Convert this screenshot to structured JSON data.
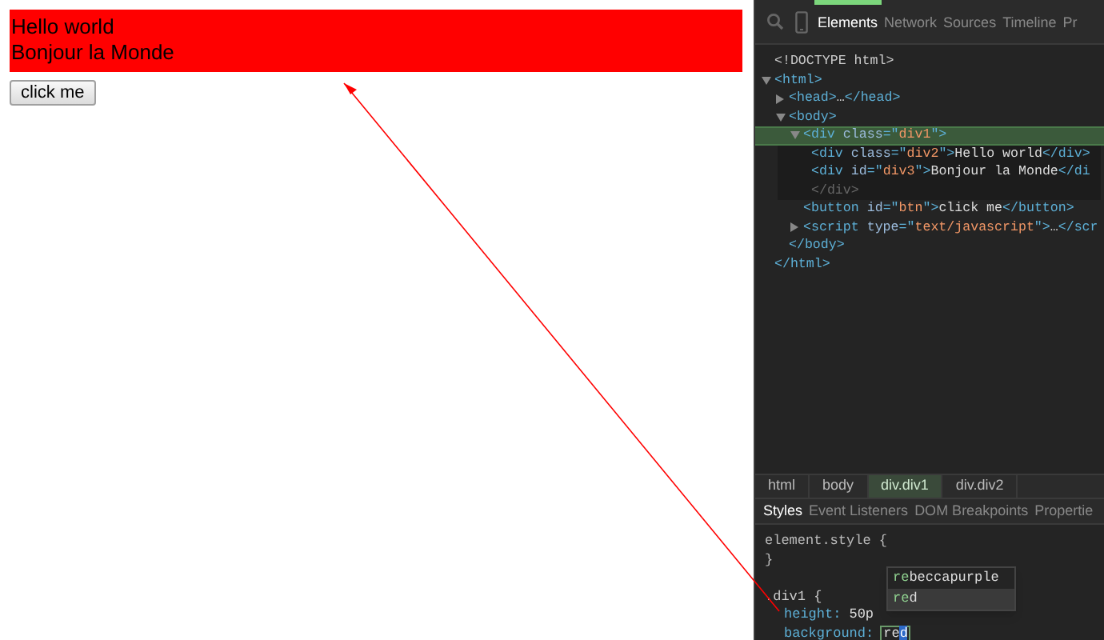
{
  "page": {
    "box_lines": [
      "Hello world",
      "Bonjour la Monde"
    ],
    "button": "click me"
  },
  "devtools": {
    "tabs": [
      {
        "label": "Elements",
        "selected": true
      },
      {
        "label": "Network",
        "selected": false
      },
      {
        "label": "Sources",
        "selected": false
      },
      {
        "label": "Timeline",
        "selected": false
      },
      {
        "label": "Pr",
        "selected": false
      }
    ],
    "tree": [
      {
        "segments": [
          {
            "doctype": "<!DOCTYPE html>"
          }
        ],
        "selected": false
      },
      {
        "segments": [
          {
            "tag": "<html>"
          }
        ],
        "expanded": true,
        "selected": false,
        "children": [
          {
            "segments": [
              {
                "tag": "<head>"
              },
              {
                "text": "…"
              },
              {
                "tag": "</head>"
              }
            ],
            "expanded": false,
            "selected": false
          },
          {
            "segments": [
              {
                "tag": "<body>"
              }
            ],
            "expanded": true,
            "selected": false,
            "children": [
              {
                "segments": [
                  {
                    "tag": "<div "
                  },
                  {
                    "attr": "class"
                  },
                  {
                    "tag": "=\""
                  },
                  {
                    "value": "div1"
                  },
                  {
                    "tag": "\">"
                  }
                ],
                "expanded": true,
                "selected": true,
                "children": [
                  {
                    "segments": [
                      {
                        "tag": "<div "
                      },
                      {
                        "attr": "class"
                      },
                      {
                        "tag": "=\""
                      },
                      {
                        "value": "div2"
                      },
                      {
                        "tag": "\">"
                      },
                      {
                        "text": "Hello world"
                      },
                      {
                        "tag": "</div>"
                      }
                    ],
                    "selected": false
                  },
                  {
                    "segments": [
                      {
                        "tag": "<div "
                      },
                      {
                        "attr": "id"
                      },
                      {
                        "tag": "=\""
                      },
                      {
                        "value": "div3"
                      },
                      {
                        "tag": "\">"
                      },
                      {
                        "text": "Bonjour la Monde"
                      },
                      {
                        "tag": "</di"
                      }
                    ],
                    "selected": false
                  }
                ],
                "closing": "</div>"
              },
              {
                "segments": [
                  {
                    "tag": "<button "
                  },
                  {
                    "attr": "id"
                  },
                  {
                    "tag": "=\""
                  },
                  {
                    "value": "btn"
                  },
                  {
                    "tag": "\">"
                  },
                  {
                    "text": "click me"
                  },
                  {
                    "tag": "</button>"
                  }
                ],
                "selected": false
              },
              {
                "segments": [
                  {
                    "tag": "<script "
                  },
                  {
                    "attr": "type"
                  },
                  {
                    "tag": "=\""
                  },
                  {
                    "value": "text/javascript"
                  },
                  {
                    "tag": "\">"
                  },
                  {
                    "text": "…"
                  },
                  {
                    "tag": "</scr"
                  }
                ],
                "expanded": false,
                "selected": false
              }
            ],
            "closing": "</body>"
          }
        ],
        "closing": "</html>"
      }
    ],
    "breadcrumbs": [
      {
        "label": "html",
        "selected": false
      },
      {
        "label": "body",
        "selected": false
      },
      {
        "label": "div.div1",
        "selected": true
      },
      {
        "label": "div.div2",
        "selected": false
      }
    ],
    "pane_tabs": [
      {
        "label": "Styles",
        "selected": true
      },
      {
        "label": "Event Listeners",
        "selected": false
      },
      {
        "label": "DOM Breakpoints",
        "selected": false
      },
      {
        "label": "Propertie",
        "selected": false
      }
    ],
    "styles": {
      "element_style_open": "element.style {",
      "element_style_close": "}",
      "rule_open": ".div1 {",
      "prop_1": "height:",
      "value_1": "50p",
      "prop_2": "background:",
      "edit_before": "re",
      "edit_selected": "d"
    },
    "suggestions": [
      {
        "text": "**re**beccapurple",
        "selected": false
      },
      {
        "text": "**re**d",
        "selected": true
      }
    ]
  }
}
